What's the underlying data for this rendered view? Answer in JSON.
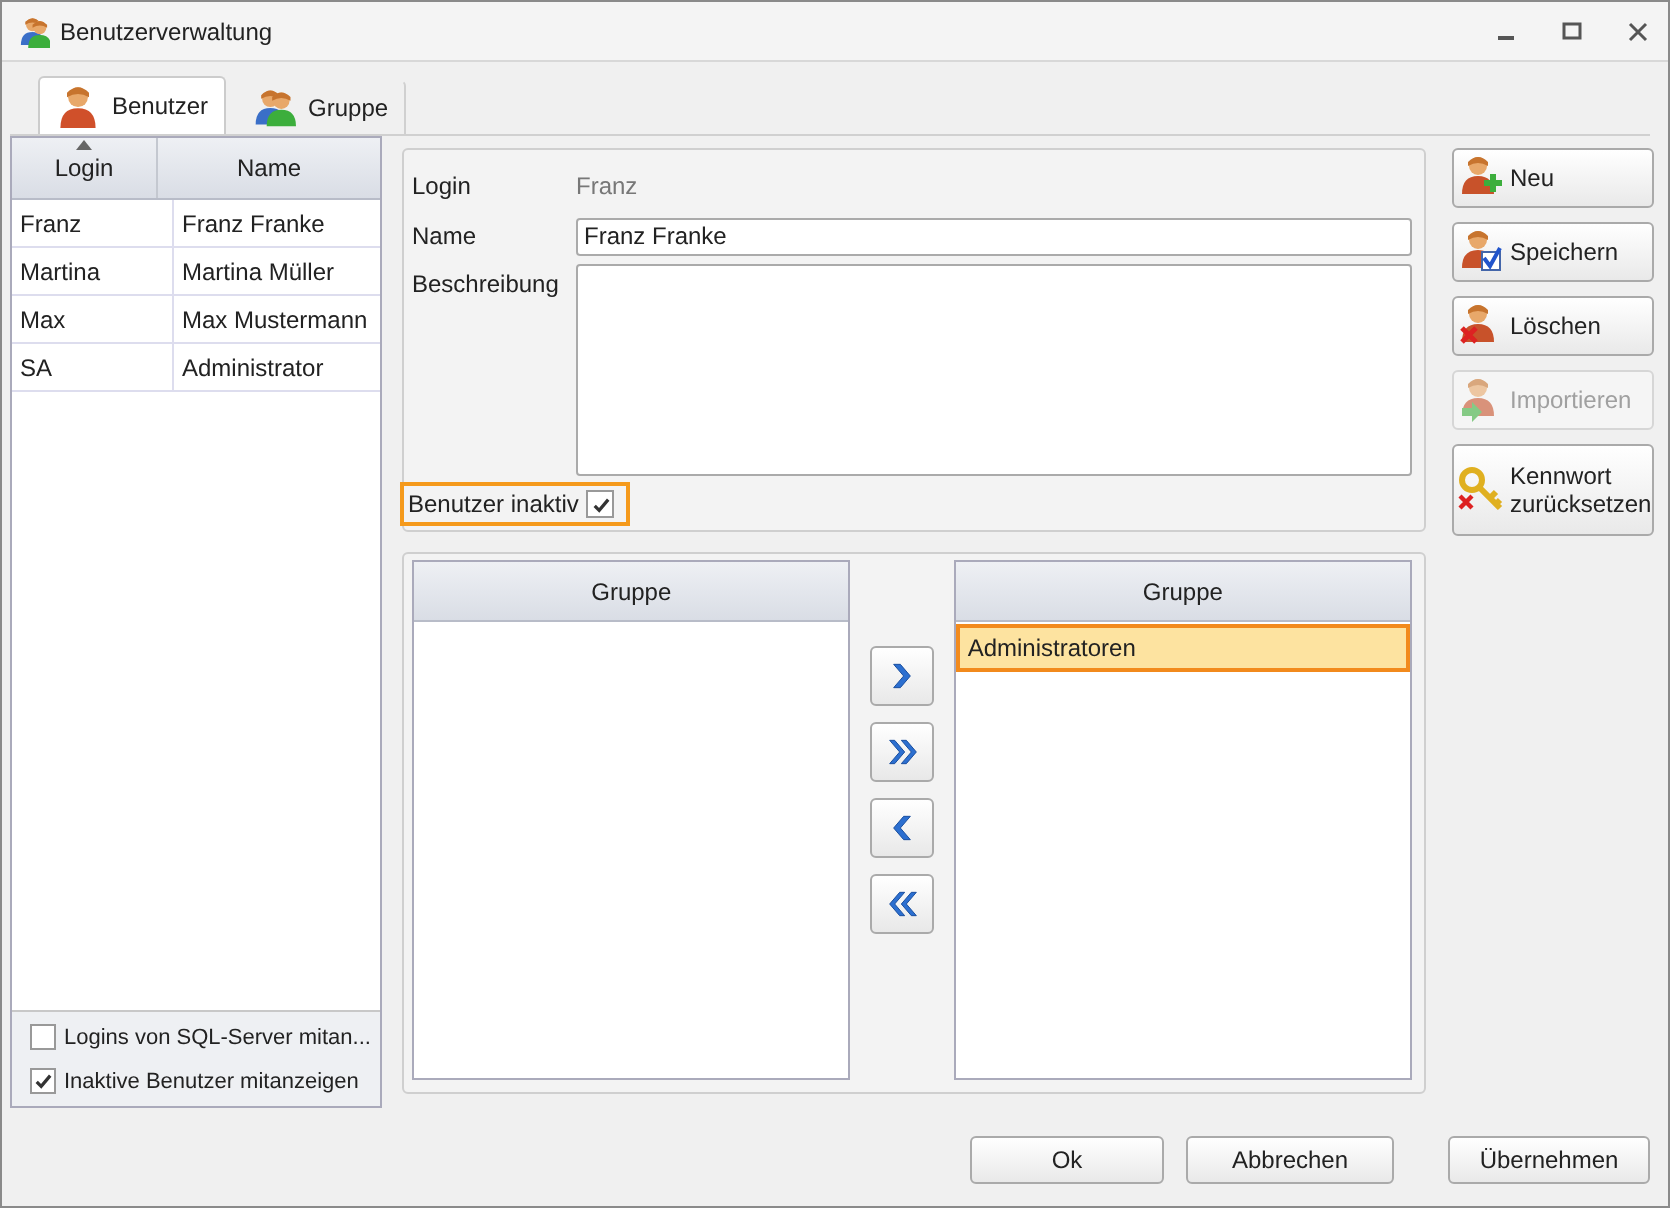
{
  "window": {
    "title": "Benutzerverwaltung"
  },
  "tabs": [
    {
      "label": "Benutzer",
      "selected": true
    },
    {
      "label": "Gruppe",
      "selected": false
    }
  ],
  "users_table": {
    "columns": [
      {
        "label": "Login",
        "sorted": true
      },
      {
        "label": "Name",
        "sorted": false
      }
    ],
    "rows": [
      {
        "login": "Franz",
        "name": "Franz Franke"
      },
      {
        "login": "Martina",
        "name": "Martina Müller"
      },
      {
        "login": "Max",
        "name": "Max Mustermann"
      },
      {
        "login": "SA",
        "name": "Administrator"
      }
    ]
  },
  "list_options": [
    {
      "label": "Logins von SQL-Server mitan...",
      "checked": false
    },
    {
      "label": "Inaktive Benutzer mitanzeigen",
      "checked": true
    }
  ],
  "form": {
    "login_label": "Login",
    "login_value": "Franz",
    "name_label": "Name",
    "name_value": "Franz Franke",
    "description_label": "Beschreibung",
    "inactive_label": "Benutzer inaktiv",
    "inactive_checked": true
  },
  "available_groups": {
    "header": "Gruppe"
  },
  "assigned_groups": {
    "header": "Gruppe",
    "items": [
      {
        "label": "Administratoren",
        "selected": true
      }
    ]
  },
  "side_buttons": [
    {
      "label": "Neu",
      "disabled": false
    },
    {
      "label": "Speichern",
      "disabled": false
    },
    {
      "label": "Löschen",
      "disabled": false
    },
    {
      "label": "Importieren",
      "disabled": true
    },
    {
      "label": "Kennwort zurücksetzen",
      "disabled": false
    }
  ],
  "footer_buttons": [
    "Ok",
    "Abbrechen"
  ],
  "apply_button": "Übernehmen"
}
